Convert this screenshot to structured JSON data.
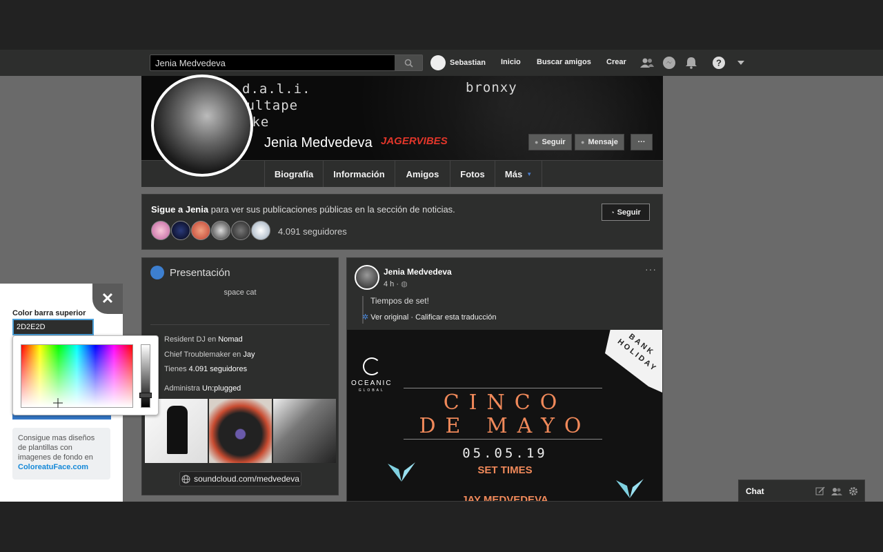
{
  "search": {
    "value": "Jenia Medvedeva",
    "icon": "search-icon"
  },
  "nav": {
    "user": "Sebastian",
    "links": [
      "Inicio",
      "Buscar amigos",
      "Crear"
    ],
    "icons": [
      "friends-icon",
      "messenger-icon",
      "bell-icon",
      "help-icon",
      "chevron-down-icon"
    ]
  },
  "cover": {
    "texts": [
      "d.a.l.i.",
      "oultape",
      "ake",
      "bronxy"
    ],
    "name": "Jenia Medvedeva",
    "logo": "JAGERVIBES",
    "buttons": {
      "follow": "Seguir",
      "message": "Mensaje",
      "more": "···"
    }
  },
  "tabs": [
    "Biografía",
    "Información",
    "Amigos",
    "Fotos",
    "Más"
  ],
  "follow_card": {
    "lead": "Sigue a Jenia",
    "text": " para ver sus publicaciones públicas en la sección de noticias.",
    "button": "Seguir",
    "followers": "4.091 seguidores"
  },
  "intro": {
    "title": "Presentación",
    "bio": "space cat",
    "lines": [
      {
        "text": "Resident DJ en ",
        "bold": "Nomad"
      },
      {
        "text": "Chief Troublemaker en ",
        "bold": "Jay"
      },
      {
        "text": "Tienes ",
        "bold": "4.091 seguidores"
      },
      {
        "text": "Administra ",
        "bold": "Un:plugged"
      }
    ],
    "link": "soundcloud.com/medvedeva"
  },
  "post": {
    "author": "Jenia Medvedeva",
    "time": "4 h ·",
    "text": "Tiempos de set!",
    "see_original": "Ver original",
    "rate_translation": "Calificar esta traducción",
    "more": "···",
    "poster": {
      "brand_line1": "OCEANIC",
      "brand_line2": "GLOBAL",
      "corner": "BANK HOLIDAY",
      "title_1": "CINCO",
      "title_2": "DE MAYO",
      "date": "05.05.19",
      "sub": "SET TIMES",
      "artist": "JAY MEDVEDEVA"
    }
  },
  "settings_panel": {
    "label": "Color barra superior",
    "value": "2D2E2D",
    "info": "Consigue mas diseños de plantillas con imagenes de fondo en ",
    "link": "ColoreatuFace.com"
  },
  "chat": {
    "label": "Chat"
  },
  "colors": {
    "topbar": "#2d2e2d",
    "background": "#6a6a6a",
    "accent": "#3578c8",
    "poster_title": "#f0895a"
  }
}
